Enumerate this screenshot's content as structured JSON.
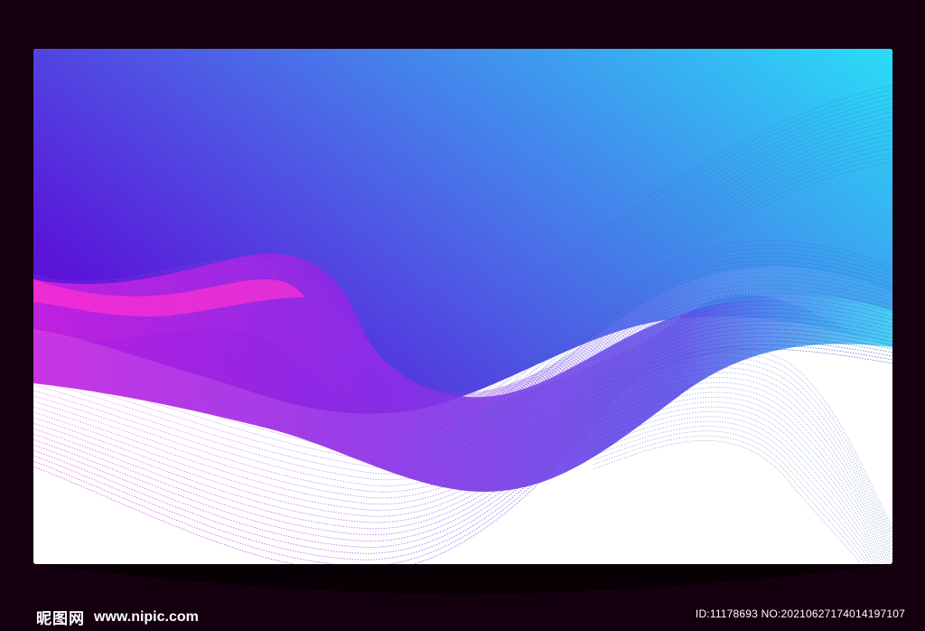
{
  "watermark": {
    "brand": "昵图网",
    "url": "www.nipic.com",
    "id_text": "ID:11178693 NO:20210627174014197107"
  },
  "colors": {
    "background": "#15000f",
    "gradient_start": "#6a1de0",
    "gradient_end": "#2adcf7",
    "accent_magenta": "#e02bd6",
    "accent_cyan": "#35d8f5",
    "accent_navy": "#2e2aa8"
  }
}
